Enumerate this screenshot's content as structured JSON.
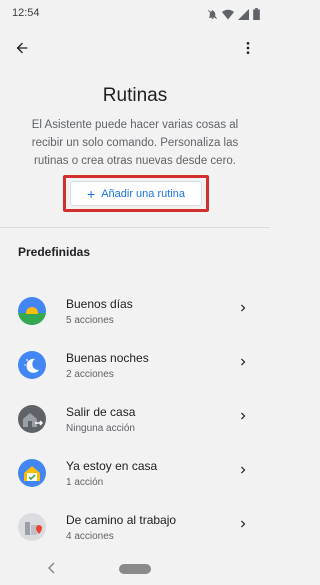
{
  "status": {
    "time": "12:54"
  },
  "header": {
    "title": "Rutinas"
  },
  "intro": {
    "description": "El Asistente puede hacer varias cosas al recibir un solo comando. Personaliza las rutinas o crea otras nuevas desde cero."
  },
  "actions": {
    "add_label": "Añadir una rutina"
  },
  "section": {
    "title": "Predefinidas"
  },
  "routines": [
    {
      "name": "Buenos días",
      "sub": "5 acciones",
      "icon": "sunrise-icon"
    },
    {
      "name": "Buenas noches",
      "sub": "2 acciones",
      "icon": "moon-icon"
    },
    {
      "name": "Salir de casa",
      "sub": "Ninguna acción",
      "icon": "leaving-home-icon"
    },
    {
      "name": "Ya estoy en casa",
      "sub": "1 acción",
      "icon": "home-check-icon"
    },
    {
      "name": "De camino al trabajo",
      "sub": "4 acciones",
      "icon": "commute-icon"
    }
  ],
  "colors": {
    "accent": "#1a73e8",
    "highlight": "#d32f2f"
  }
}
